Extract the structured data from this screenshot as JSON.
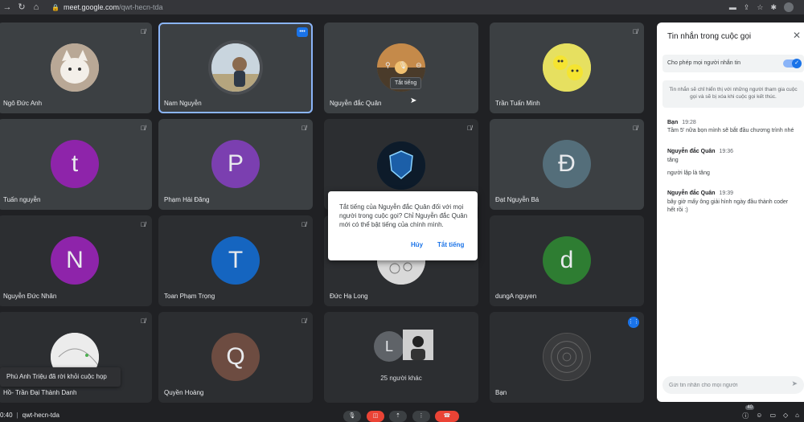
{
  "browser": {
    "url_host": "meet.google.com",
    "url_path": "/qwt-hecn-tda"
  },
  "tiles": [
    {
      "name": "Ngô Đức Anh",
      "avatar_letter": "",
      "avatar_color": "#d5c7b8"
    },
    {
      "name": "Nam Nguyễn",
      "avatar_letter": "",
      "avatar_color": "#a9b8c4"
    },
    {
      "name": "Nguyễn đắc Quân",
      "avatar_letter": "",
      "avatar_color": "#7a6a4f",
      "tooltip": "Tắt tiếng"
    },
    {
      "name": "Trần Tuấn Minh",
      "avatar_letter": "",
      "avatar_color": "#d8d34a"
    },
    {
      "name": "Tuấn nguyễn",
      "avatar_letter": "t",
      "avatar_color": "#8e24aa"
    },
    {
      "name": "Phạm Hải Đăng",
      "avatar_letter": "P",
      "avatar_color": "#7b3fb0"
    },
    {
      "name": "",
      "avatar_letter": "",
      "avatar_color": "#0b2a4a"
    },
    {
      "name": "Đạt Nguyễn Bá",
      "avatar_letter": "Đ",
      "avatar_color": "#546e7a"
    },
    {
      "name": "Nguyễn Đức Nhân",
      "avatar_letter": "N",
      "avatar_color": "#8e24aa"
    },
    {
      "name": "Toan Phạm Trọng",
      "avatar_letter": "T",
      "avatar_color": "#1565c0"
    },
    {
      "name": "Đức Hạ Long",
      "avatar_letter": "",
      "avatar_color": "#c8c8c8"
    },
    {
      "name": "dungA nguyen",
      "avatar_letter": "d",
      "avatar_color": "#2e7d32"
    },
    {
      "name": "Trần Đại Thành Danh",
      "avatar_letter": "",
      "avatar_color": "#e0e0e0"
    },
    {
      "name": "Quyền Hoàng",
      "avatar_letter": "Q",
      "avatar_color": "#6d4c41"
    },
    {
      "name": "",
      "avatar_letter": "",
      "avatar_color": "#5f6368"
    },
    {
      "name": "Bạn",
      "avatar_letter": "",
      "avatar_color": "#3a3b3d"
    }
  ],
  "others_tile": {
    "letter": "L",
    "count_label": "25 người khác"
  },
  "dialog": {
    "text": "Tắt tiếng của Nguyễn đắc Quân đối với mọi người trong cuộc gọi? Chỉ Nguyễn đắc Quân mới có thể bật tiếng của chính mình.",
    "cancel": "Hủy",
    "confirm": "Tắt tiếng"
  },
  "toast": {
    "text": "Phú Anh Triệu đã rời khỏi cuộc họp"
  },
  "bottom": {
    "time": "0:40",
    "meeting_code": "qwt-hecn-tda",
    "badge": "40"
  },
  "chat": {
    "title": "Tin nhắn trong cuộc gọi",
    "toggle_label": "Cho phép mọi người nhắn tin",
    "notice": "Tin nhắn sẽ chỉ hiển thị với những người tham gia cuộc gọi và sẽ bị xóa khi cuộc gọi kết thúc.",
    "messages": [
      {
        "sender": "Bạn",
        "time": "19:28",
        "lines": [
          "Tầm 5' nữa bọn mình sẽ bắt đầu chương trình nhé"
        ]
      },
      {
        "sender": "Nguyễn đắc Quân",
        "time": "19:36",
        "lines": [
          "tăng",
          "người lập là tăng"
        ]
      },
      {
        "sender": "Nguyễn đắc Quân",
        "time": "19:39",
        "lines": [
          "bây giờ mấy ông giải hình ngày đầu thành coder hết rồi :)"
        ]
      }
    ],
    "compose_placeholder": "Gửi tin nhắn cho mọi người"
  },
  "colors": {
    "accent": "#1a73e8",
    "tile_bg": "#3c4043",
    "danger": "#ea4335"
  }
}
